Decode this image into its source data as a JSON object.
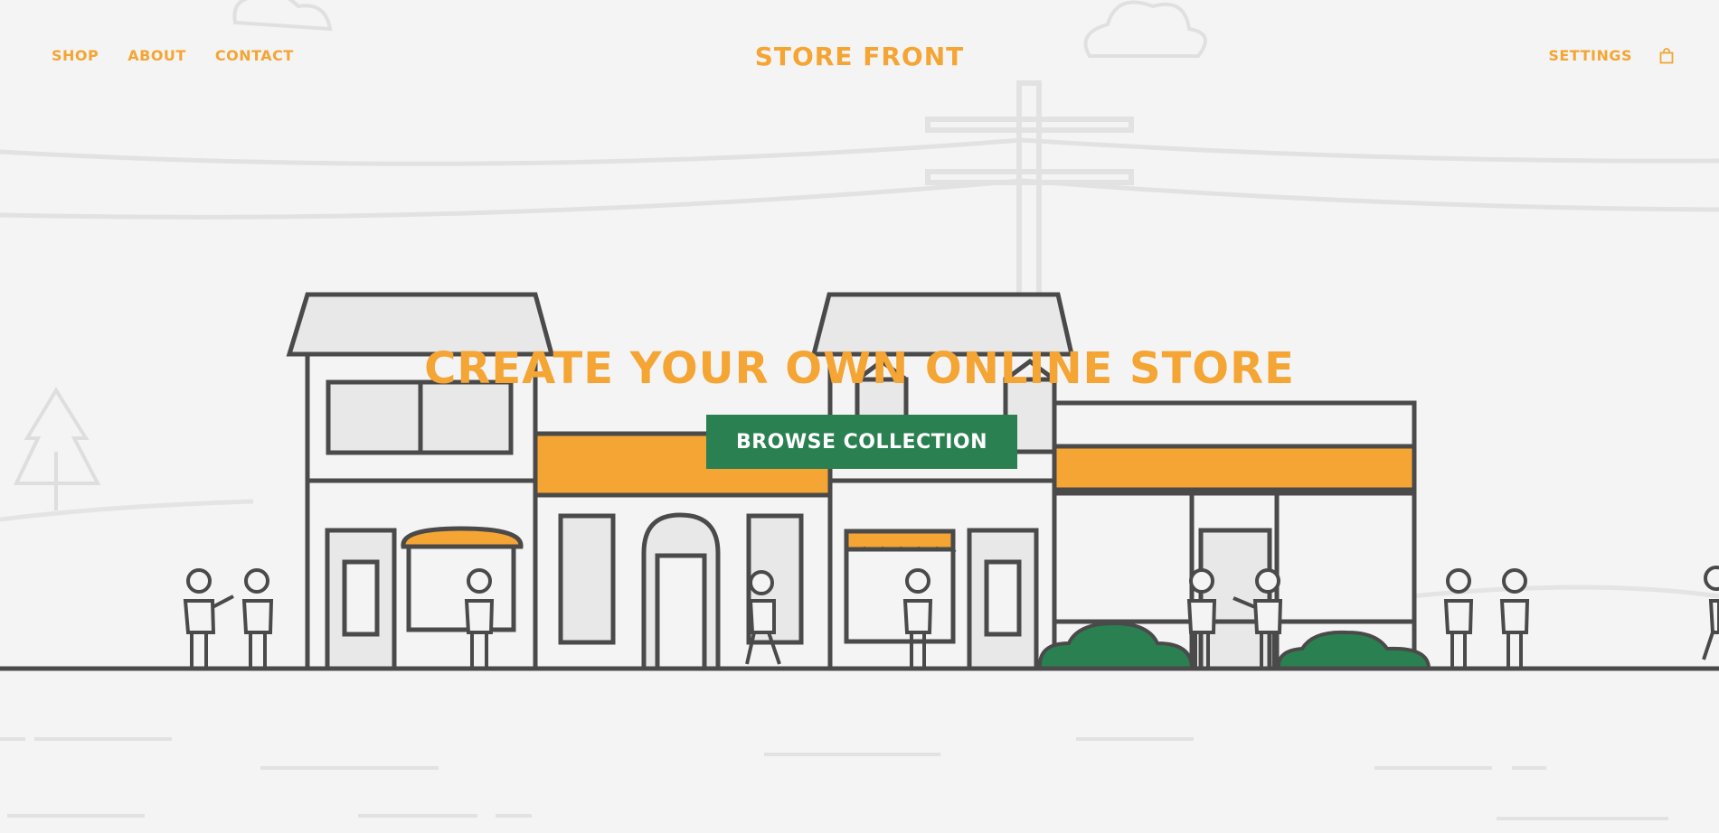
{
  "header": {
    "nav_left": [
      {
        "label": "SHOP"
      },
      {
        "label": "ABOUT"
      },
      {
        "label": "CONTACT"
      }
    ],
    "brand": "STORE FRONT",
    "nav_right": {
      "settings_label": "SETTINGS",
      "cart_icon": "shopping-bag-icon"
    }
  },
  "hero": {
    "title": "CREATE YOUR OWN ONLINE STORE",
    "cta_label": "BROWSE COLLECTION"
  },
  "colors": {
    "accent": "#f4a534",
    "cta_bg": "#2a8050",
    "line": "#4a4a4a",
    "background": "#f4f4f4",
    "bush": "#2a8050"
  }
}
